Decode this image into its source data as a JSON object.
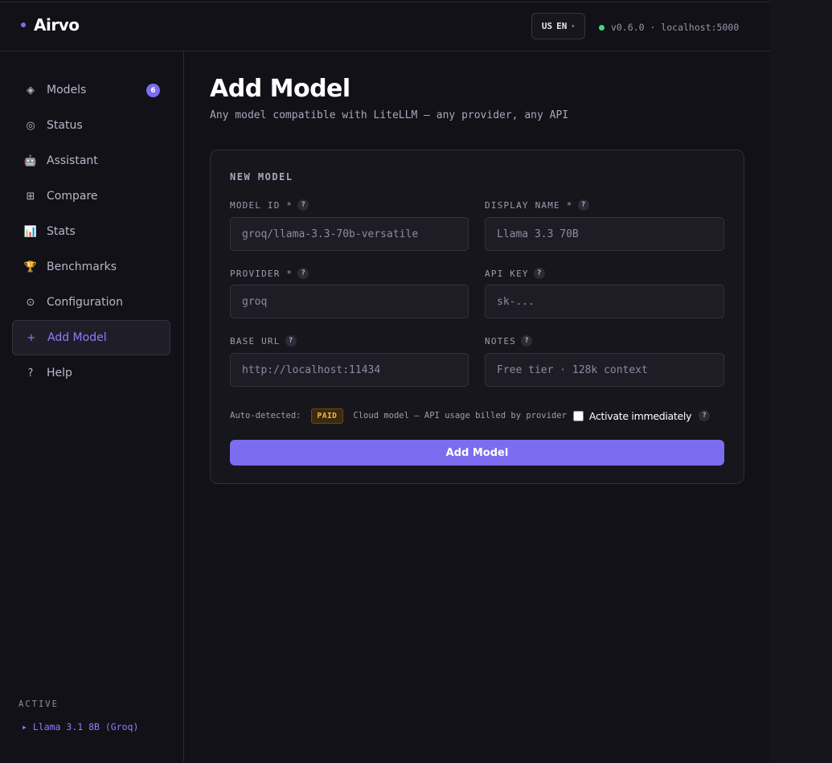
{
  "app": {
    "name": "Airvo",
    "language": {
      "flag": "US",
      "code": "EN"
    },
    "version_text": "v0.6.0 · localhost:5000"
  },
  "sidebar": {
    "items": [
      {
        "label": "Models",
        "icon": "◈",
        "badge": "6"
      },
      {
        "label": "Status",
        "icon": "◎"
      },
      {
        "label": "Assistant",
        "icon": "🤖"
      },
      {
        "label": "Compare",
        "icon": "⊞"
      },
      {
        "label": "Stats",
        "icon": "📊"
      },
      {
        "label": "Benchmarks",
        "icon": "🏆"
      },
      {
        "label": "Configuration",
        "icon": "⊙"
      },
      {
        "label": "Add Model",
        "icon": "+"
      },
      {
        "label": "Help",
        "icon": "?"
      }
    ],
    "active_item": "Add Model",
    "active_section_label": "ACTIVE",
    "active_model": "▸ Llama 3.1 8B (Groq)"
  },
  "main": {
    "title": "Add Model",
    "subtitle": "Any model compatible with LiteLLM — any provider, any API",
    "form": {
      "section_title": "NEW MODEL",
      "help_glyph": "?",
      "fields": {
        "model_id": {
          "label": "MODEL ID *",
          "placeholder": "groq/llama-3.3-70b-versatile"
        },
        "display_name": {
          "label": "DISPLAY NAME *",
          "placeholder": "Llama 3.3 70B"
        },
        "provider": {
          "label": "PROVIDER *",
          "placeholder": "groq"
        },
        "api_key": {
          "label": "API KEY",
          "placeholder": "sk-..."
        },
        "base_url": {
          "label": "BASE URL",
          "placeholder": "http://localhost:11434"
        },
        "notes": {
          "label": "NOTES",
          "placeholder": "Free tier · 128k context"
        }
      },
      "auto_detected_label": "Auto-detected:",
      "auto_detected_badge": "PAID",
      "auto_detected_text": "Cloud model — API usage billed by provider",
      "activate_label": "Activate immediately",
      "activate_checked": false,
      "submit_label": "Add Model"
    }
  },
  "colors": {
    "accent": "#7c6cf0",
    "background": "#121117",
    "paid_badge": "#f4b740",
    "status_online": "#3ddc84"
  }
}
